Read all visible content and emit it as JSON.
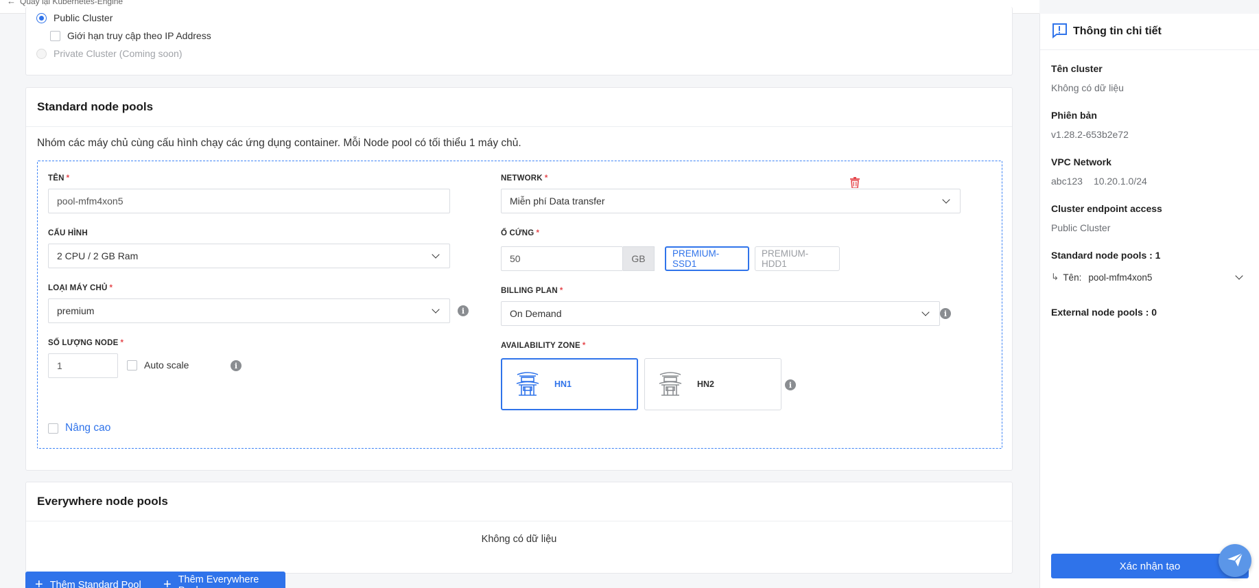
{
  "top": {
    "back_label": "Quay lại Kubernetes-Engine"
  },
  "access": {
    "public_label": "Public Cluster",
    "ip_limit_label": "Giới hạn truy cập theo IP Address",
    "private_label": "Private Cluster (Coming soon)"
  },
  "standard": {
    "title": "Standard node pools",
    "description": "Nhóm các máy chủ cùng cấu hình chạy các ứng dụng container. Mỗi Node pool có tối thiểu 1 máy chủ.",
    "pool": {
      "name_label": "TÊN",
      "name_value": "pool-mfm4xon5",
      "config_label": "CẤU HÌNH",
      "config_value": "2 CPU / 2 GB Ram",
      "server_type_label": "LOẠI MÁY CHỦ",
      "server_type_value": "premium",
      "node_count_label": "SỐ LƯỢNG NODE",
      "node_count_value": "1",
      "autoscale_label": "Auto scale",
      "advanced_label": "Nâng cao",
      "network_label": "NETWORK",
      "network_value": "Miễn phí Data transfer",
      "disk_label": "Ổ CỨNG",
      "disk_value": "50",
      "disk_unit": "GB",
      "disk_types": [
        "PREMIUM-SSD1",
        "PREMIUM-HDD1"
      ],
      "disk_type_selected": "PREMIUM-SSD1",
      "billing_label": "BILLING PLAN",
      "billing_value": "On Demand",
      "zone_label": "AVAILABILITY ZONE",
      "zones": [
        "HN1",
        "HN2"
      ],
      "zone_selected": "HN1"
    }
  },
  "everywhere": {
    "title": "Everywhere node pools",
    "empty": "Không có dữ liệu"
  },
  "buttons": {
    "add_standard": "Thêm Standard Pool",
    "add_everywhere": "Thêm Everywhere Pool"
  },
  "panel": {
    "title": "Thông tin chi tiết",
    "cluster_name_label": "Tên cluster",
    "cluster_name_value": "Không có dữ liệu",
    "version_label": "Phiên bản",
    "version_value": "v1.28.2-653b2e72",
    "vpc_label": "VPC Network",
    "vpc_name": "abc123",
    "vpc_cidr": "10.20.1.0/24",
    "endpoint_label": "Cluster endpoint access",
    "endpoint_value": "Public Cluster",
    "standard_pools_label": "Standard node pools : 1",
    "pool_name_label": "Tên:",
    "pool_name_value": "pool-mfm4xon5",
    "external_pools_label": "External node pools : 0",
    "confirm_label": "Xác nhận tạo"
  },
  "colors": {
    "primary": "#2f73ea",
    "danger": "#e5484d"
  }
}
